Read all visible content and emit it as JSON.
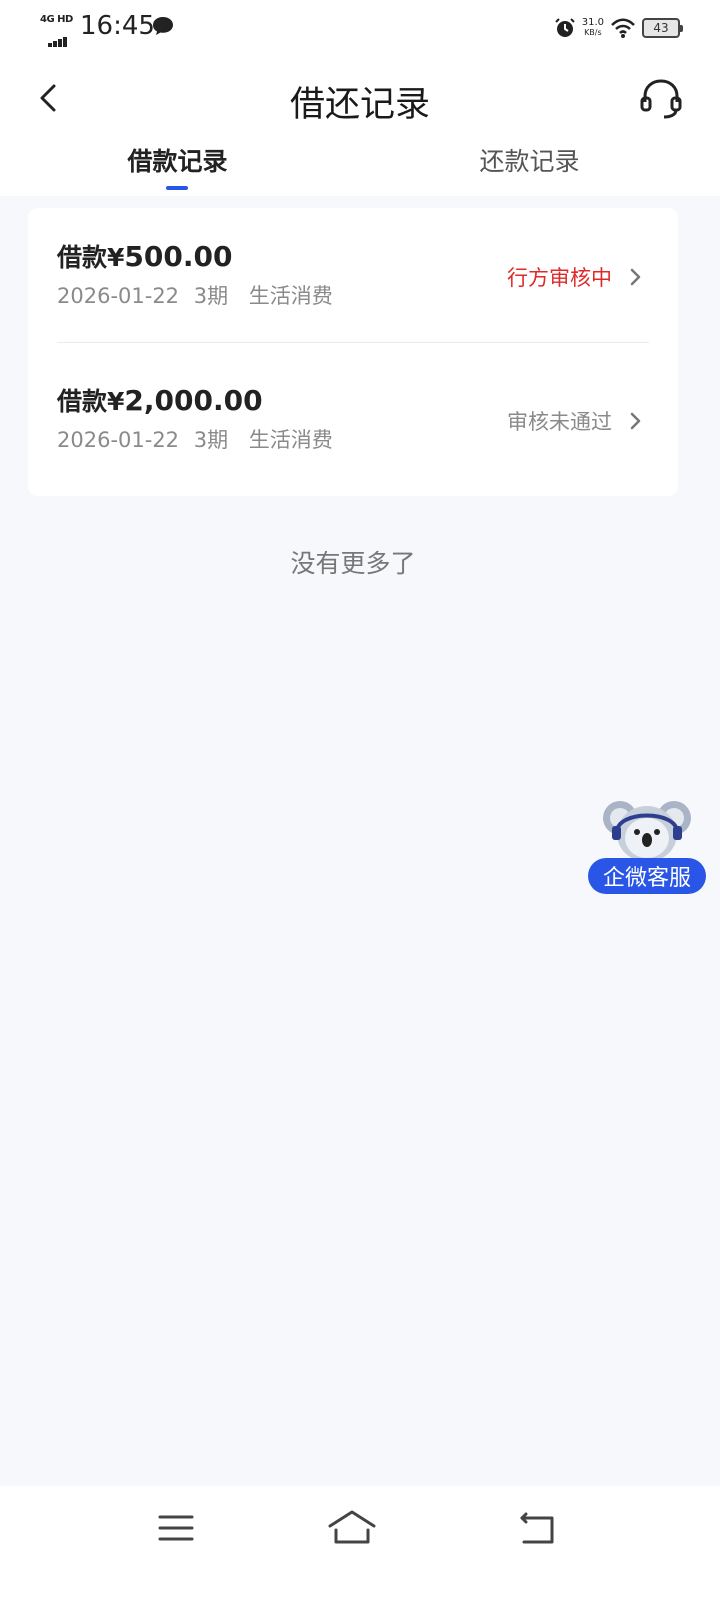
{
  "status_bar": {
    "network": "4G HD",
    "time": "16:45",
    "speed_value": "31.0",
    "speed_unit": "KB/s",
    "battery": "43",
    "icons": [
      "network-signal-icon",
      "message-icon",
      "alarm-icon",
      "wifi-icon",
      "battery-icon"
    ]
  },
  "header": {
    "title": "借还记录",
    "back_icon": "chevron-left-icon",
    "service_icon": "headset-icon"
  },
  "tabs": [
    {
      "label": "借款记录",
      "active": true
    },
    {
      "label": "还款记录",
      "active": false
    }
  ],
  "records": [
    {
      "amount_prefix": "借款¥",
      "amount": "500.00",
      "date": "2026-01-22",
      "term": "3期",
      "purpose": "生活消费",
      "status": "行方审核中",
      "status_color": "#e02a2a"
    },
    {
      "amount_prefix": "借款¥",
      "amount": "2,000.00",
      "date": "2026-01-22",
      "term": "3期",
      "purpose": "生活消费",
      "status": "审核未通过",
      "status_color": "#8a8a8a"
    }
  ],
  "footer_text": "没有更多了",
  "floating_service": {
    "label": "企微客服",
    "icon": "koala-mascot-icon"
  },
  "nav_bar": {
    "icons": [
      "menu-icon",
      "home-icon",
      "back-icon"
    ]
  },
  "colors": {
    "accent": "#2a56e8",
    "status_pending": "#e02a2a",
    "status_rejected": "#8a8a8a",
    "background": "#f7f8fc"
  }
}
